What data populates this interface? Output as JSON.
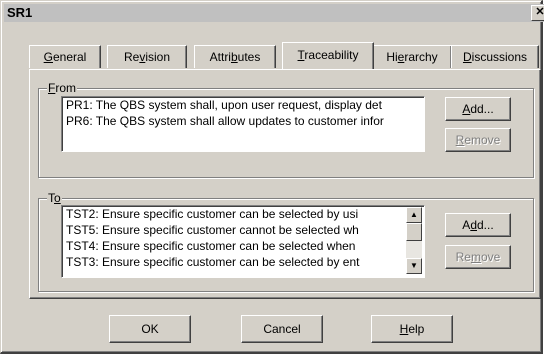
{
  "window": {
    "title": "SR1",
    "close_glyph": "✕"
  },
  "tabs": [
    {
      "label_pre": "",
      "key": "G",
      "label_post": "eneral"
    },
    {
      "label_pre": "Re",
      "key": "v",
      "label_post": "ision"
    },
    {
      "label_pre": "Attri",
      "key": "b",
      "label_post": "utes"
    },
    {
      "label_pre": "",
      "key": "T",
      "label_post": "raceability"
    },
    {
      "label_pre": "Hi",
      "key": "e",
      "label_post": "rarchy"
    },
    {
      "label_pre": "",
      "key": "D",
      "label_post": "iscussions"
    }
  ],
  "active_tab": "Traceability",
  "from": {
    "label_key": "F",
    "label_post": "rom",
    "items": [
      "PR1: The QBS system shall, upon user request, display det",
      "PR6: The QBS system shall allow updates to customer infor"
    ],
    "add_pre": "",
    "add_key": "A",
    "add_post": "dd...",
    "remove_pre": "",
    "remove_key": "R",
    "remove_post": "emove"
  },
  "to": {
    "label_pre": "T",
    "label_key": "o",
    "label_post": "",
    "items": [
      "TST2: Ensure specific customer can be selected by usi",
      "TST5: Ensure specific customer cannot be selected wh",
      "TST4: Ensure specific customer can be selected when",
      "TST3: Ensure specific customer can be selected by ent"
    ],
    "add_pre": "A",
    "add_key": "d",
    "add_post": "d...",
    "remove_pre": "Re",
    "remove_key": "m",
    "remove_post": "ove",
    "scroll_up": "▲",
    "scroll_down": "▼"
  },
  "footer": {
    "ok_label": "OK",
    "cancel_label": "Cancel",
    "help_key": "H",
    "help_post": "elp"
  }
}
